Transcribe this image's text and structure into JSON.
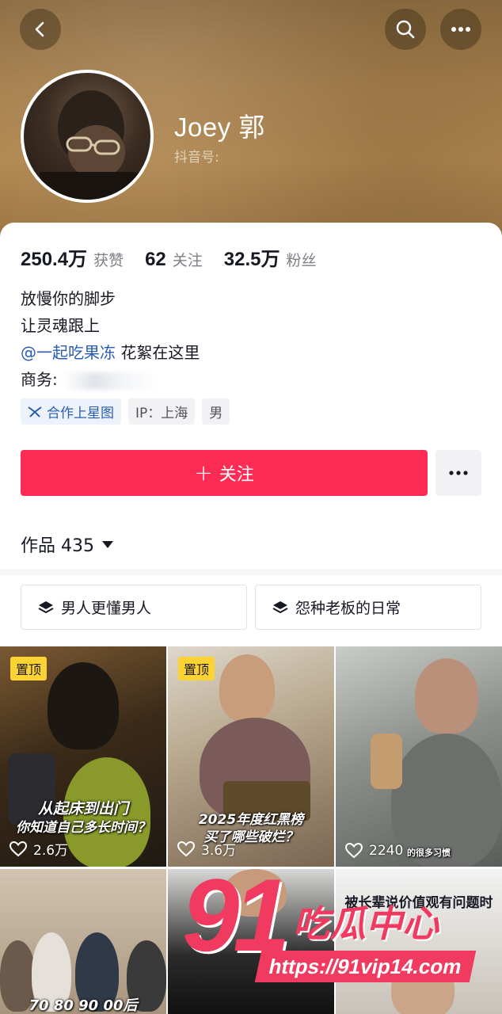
{
  "profile": {
    "name": "Joey 郭",
    "douyin_id_label": "抖音号:",
    "stats": [
      {
        "value": "250.4万",
        "label": "获赞"
      },
      {
        "value": "62",
        "label": "关注"
      },
      {
        "value": "32.5万",
        "label": "粉丝"
      }
    ],
    "bio": {
      "line1": "放慢你的脚步",
      "line2": "让灵魂跟上",
      "mention": "@一起吃果冻",
      "mention_suffix": " 花絮在这里",
      "business_label": "商务:"
    },
    "tags": {
      "star": "合作上星图",
      "ip": "IP：上海",
      "gender": "男"
    }
  },
  "actions": {
    "follow_label": "关注"
  },
  "works": {
    "label": "作品 435"
  },
  "collections": [
    {
      "label": "男人更懂男人"
    },
    {
      "label": "怨种老板的日常"
    }
  ],
  "videos": [
    {
      "pinned_label": "置顶",
      "caption_1": "从起床到出门",
      "caption_2": "你知道自己多长时间？",
      "likes": "2.6万"
    },
    {
      "pinned_label": "置顶",
      "caption_1": "2025年度红黑榜",
      "caption_2": "买了哪些破烂？",
      "likes": "3.6万"
    },
    {
      "likes": "2240",
      "caption_1": "的很多习惯"
    },
    {
      "caption_1": "70 80 90 00后"
    },
    {},
    {
      "caption_1": "被长辈说价值观有问题时"
    }
  ],
  "watermark": {
    "number": "91",
    "text": "吃瓜中心",
    "url": "https://91vip14.com"
  },
  "colors": {
    "accent": "#fe2c55",
    "mention": "#2a5db0",
    "pin": "#fdd334",
    "banner": "#a57e4b"
  },
  "icons": [
    "back-arrow-icon",
    "search-icon",
    "more-dots-icon",
    "star-map-icon",
    "plus-icon",
    "caret-down-icon",
    "layers-icon",
    "heart-icon"
  ]
}
